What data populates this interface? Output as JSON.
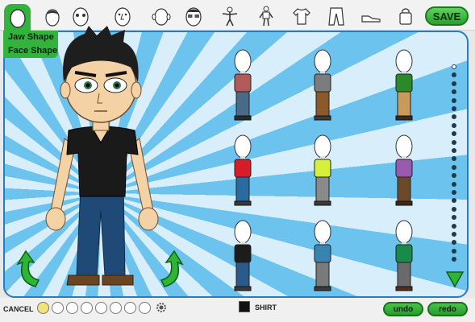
{
  "toolbar": {
    "tabs": [
      "face-shape",
      "hair",
      "eyes",
      "nose",
      "ears",
      "glasses",
      "body",
      "pose",
      "shirt",
      "pants",
      "shoes",
      "bag"
    ],
    "save_label": "SAVE",
    "accent": "#32b33c"
  },
  "submenu": {
    "items": [
      "Jaw Shape",
      "Face Shape"
    ]
  },
  "catalog": {
    "items": [
      {
        "shirt": "#b05a5a",
        "pants": "#4a6a8a",
        "shoes": "#2a2a2a"
      },
      {
        "shirt": "#7c7c7c",
        "pants": "#8a5a2a",
        "shoes": "#3a3a3a"
      },
      {
        "shirt": "#2a8a2a",
        "pants": "#c99a5a",
        "shoes": "#3a2a1a"
      },
      {
        "shirt": "#d81d2a",
        "pants": "#2a6aa0",
        "shoes": "#3a3a3a"
      },
      {
        "shirt": "#d4f03a",
        "pants": "#8a8a8a",
        "shoes": "#3a3a3a"
      },
      {
        "shirt": "#9a5ab0",
        "pants": "#6a4a2a",
        "shoes": "#3a2a1a"
      },
      {
        "shirt": "#1c1c1c",
        "pants": "#2a5a8a",
        "shoes": "#3a3a3a"
      },
      {
        "shirt": "#3a82b0",
        "pants": "#7a7a7a",
        "shoes": "#3a3a3a"
      },
      {
        "shirt": "#1a8a4a",
        "pants": "#6a6a6a",
        "shoes": "#5a2a1a"
      }
    ]
  },
  "bottom": {
    "cancel_label": "CANCEL",
    "shirt_label": "SHIRT",
    "undo_label": "undo",
    "redo_label": "redo"
  }
}
